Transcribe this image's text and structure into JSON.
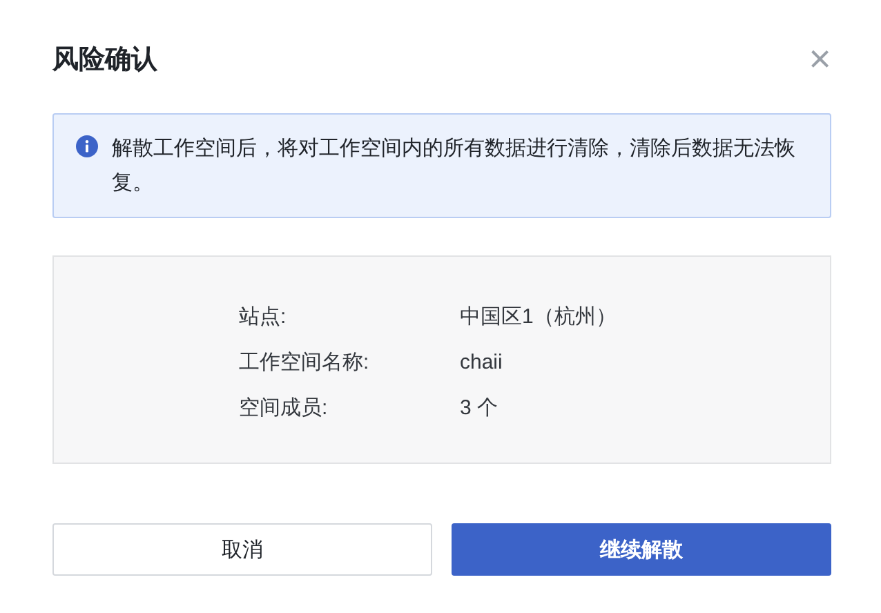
{
  "dialog": {
    "title": "风险确认",
    "close": "×"
  },
  "alert": {
    "message": "解散工作空间后，将对工作空间内的所有数据进行清除，清除后数据无法恢复。"
  },
  "details": [
    {
      "label": "站点:",
      "value": "中国区1（杭州）"
    },
    {
      "label": "工作空间名称:",
      "value": "chaii"
    },
    {
      "label": "空间成员:",
      "value": "3 个"
    }
  ],
  "buttons": [
    {
      "label": "取消",
      "kind": "default"
    },
    {
      "label": "继续解散",
      "kind": "primary"
    }
  ]
}
